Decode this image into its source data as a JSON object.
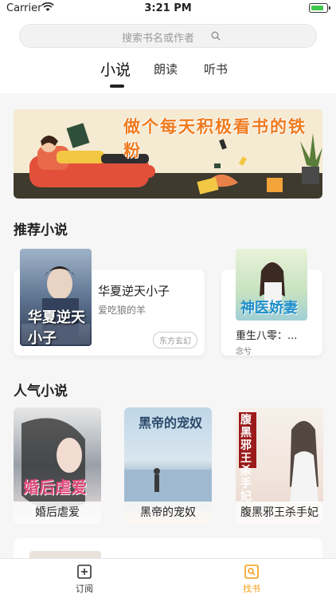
{
  "status_bar": {
    "carrier": "Carrier",
    "time": "3:21 PM",
    "battery_level": 0.85
  },
  "search": {
    "placeholder": "搜索书名或作者"
  },
  "tabs": [
    {
      "label": "小说",
      "active": true
    },
    {
      "label": "朗读",
      "active": false
    },
    {
      "label": "听书",
      "active": false
    }
  ],
  "banner": {
    "text": "做个每天积极看书的铁粉"
  },
  "recommended": {
    "title": "推荐小说",
    "books": [
      {
        "title": "华夏逆天小子",
        "author": "爱吃狼的羊",
        "tag": "东方玄幻",
        "cover_text": "华夏逆天小子"
      },
      {
        "title": "重生八零：...",
        "author": "念兮",
        "cover_text": "神医娇妻"
      }
    ]
  },
  "popular": {
    "title": "人气小说",
    "books": [
      {
        "title": "婚后虐爱",
        "cover_text": "婚后虐爱"
      },
      {
        "title": "黑帝的宠奴",
        "cover_text": "黑帝的宠奴"
      },
      {
        "title": "腹黑邪王杀手妃",
        "cover_text": "腹黑邪王 杀手妃"
      }
    ]
  },
  "tabbar": [
    {
      "label": "订阅",
      "active": false
    },
    {
      "label": "找书",
      "active": true
    }
  ],
  "colors": {
    "accent": "#f39c12",
    "highlight": "#f6dcb6",
    "banner_text": "#f07a1e"
  }
}
